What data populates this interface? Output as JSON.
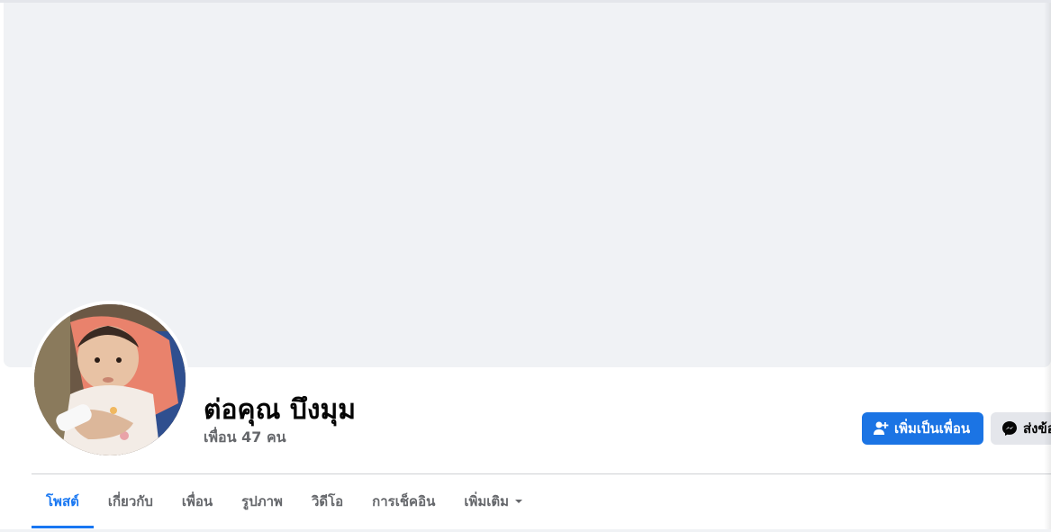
{
  "profile": {
    "name": "ต่อคุณ บึงมุม",
    "friends_count": "เพื่อน 47 คน"
  },
  "actions": {
    "add_friend_label": "เพิ่มเป็นเพื่อน",
    "message_label": "ส่งข้อความ"
  },
  "tabs": [
    {
      "label": "โพสต์",
      "active": true
    },
    {
      "label": "เกี่ยวกับ"
    },
    {
      "label": "เพื่อน"
    },
    {
      "label": "รูปภาพ"
    },
    {
      "label": "วิดีโอ"
    },
    {
      "label": "การเช็คอิน"
    },
    {
      "label": "เพิ่มเติม"
    }
  ],
  "colors": {
    "accent": "#1877f2",
    "primary_button": "#1b74e4",
    "secondary_button": "#e4e6eb",
    "cover": "#f0f2f5",
    "muted_text": "#65676b"
  },
  "icons": {
    "add_friend": "person-plus-icon",
    "message": "messenger-icon",
    "more": "caret-down-icon"
  }
}
